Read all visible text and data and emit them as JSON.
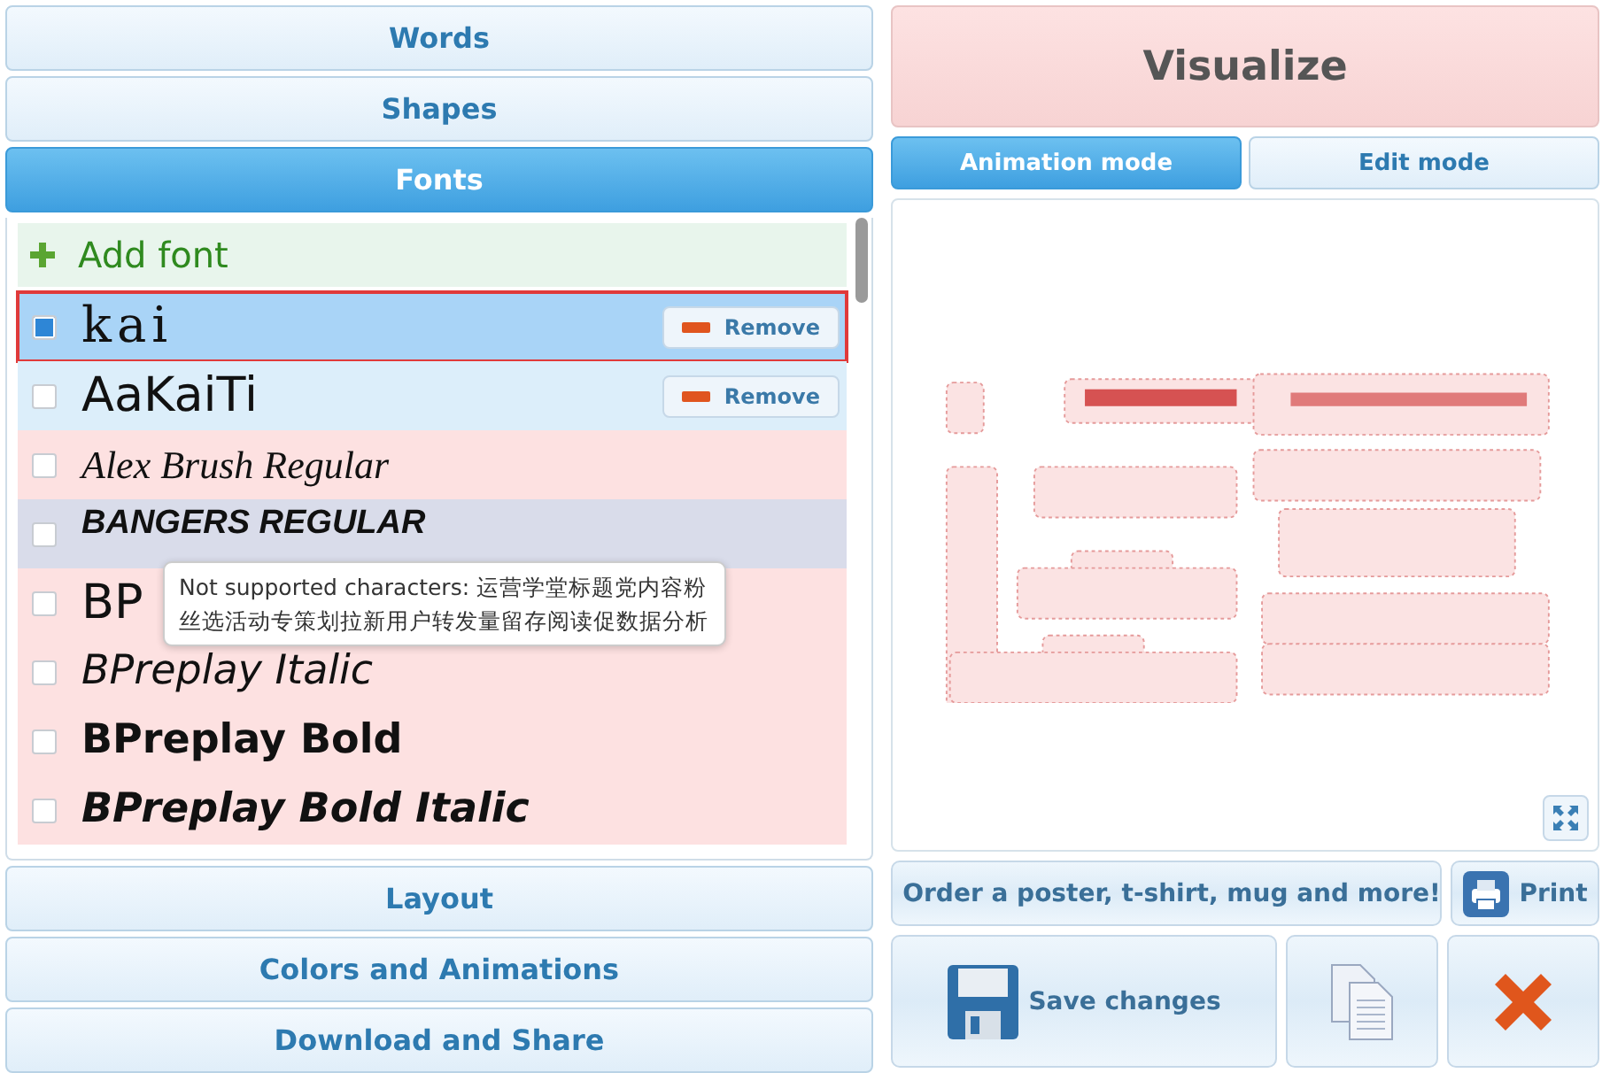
{
  "sections_top": [
    {
      "label": "Words",
      "expanded": false
    },
    {
      "label": "Shapes",
      "expanded": false
    },
    {
      "label": "Fonts",
      "expanded": true
    }
  ],
  "fonts": {
    "add_label": "Add font",
    "items": [
      {
        "name": "kai",
        "kind": "serif",
        "checked": true,
        "selected": true,
        "color": "#a9d4f7",
        "remove": "Remove"
      },
      {
        "name": "AaKaiTi",
        "kind": "sans",
        "checked": false,
        "selected": false,
        "color": "#dceefa",
        "remove": "Remove"
      },
      {
        "name": "Alex Brush Regular",
        "kind": "script",
        "checked": false,
        "selected": false,
        "color": "#fde1e1"
      },
      {
        "name": "BANGERS REGULAR",
        "kind": "display",
        "checked": false,
        "selected": false,
        "color": "#d9dcea"
      },
      {
        "name": "BP",
        "kind": "sans",
        "checked": false,
        "selected": false,
        "color": "#fde1e1"
      },
      {
        "name": "BPreplay Italic",
        "kind": "italic",
        "checked": false,
        "selected": false,
        "color": "#fde1e1"
      },
      {
        "name": "BPreplay Bold",
        "kind": "bold",
        "checked": false,
        "selected": false,
        "color": "#fde1e1"
      },
      {
        "name": "BPreplay Bold Italic",
        "kind": "bolditalic",
        "checked": false,
        "selected": false,
        "color": "#fde1e1"
      }
    ],
    "tooltip": "Not supported characters: 运营学堂标题党内容粉丝选活动专策划拉新用户转发量留存阅读促数据分析"
  },
  "sections_bottom": [
    {
      "label": "Layout",
      "expanded": false
    },
    {
      "label": "Colors and Animations",
      "expanded": false
    },
    {
      "label": "Download and Share",
      "expanded": false
    }
  ],
  "visualize": "Visualize",
  "modes": [
    {
      "label": "Animation mode",
      "selected": true
    },
    {
      "label": "Edit mode",
      "selected": false
    }
  ],
  "order_button": "Order a poster, t-shirt, mug and more!",
  "print_button": "Print",
  "save_button": "Save changes"
}
